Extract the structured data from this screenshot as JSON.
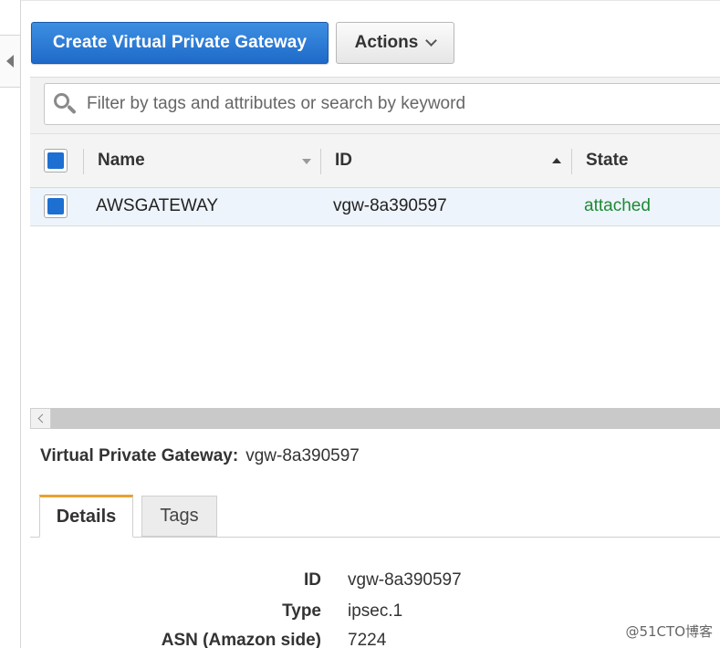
{
  "toolbar": {
    "create_label": "Create Virtual Private Gateway",
    "actions_label": "Actions"
  },
  "search": {
    "placeholder": "Filter by tags and attributes or search by keyword"
  },
  "table": {
    "columns": [
      "Name",
      "ID",
      "State"
    ],
    "rows": [
      {
        "name": "AWSGATEWAY",
        "id": "vgw-8a390597",
        "state": "attached",
        "selected": true
      }
    ]
  },
  "details": {
    "title_label": "Virtual Private Gateway:",
    "title_value": "vgw-8a390597",
    "tabs": [
      "Details",
      "Tags"
    ],
    "fields": [
      {
        "label": "ID",
        "value": "vgw-8a390597"
      },
      {
        "label": "Type",
        "value": "ipsec.1"
      },
      {
        "label": "ASN (Amazon side)",
        "value": "7224"
      }
    ]
  },
  "watermark": "@51CTO博客",
  "colors": {
    "primary": "#1f6ac9",
    "state_attached": "#1d8a34",
    "active_tab_accent": "#e9a12e",
    "selected_row": "#eef4fb"
  }
}
